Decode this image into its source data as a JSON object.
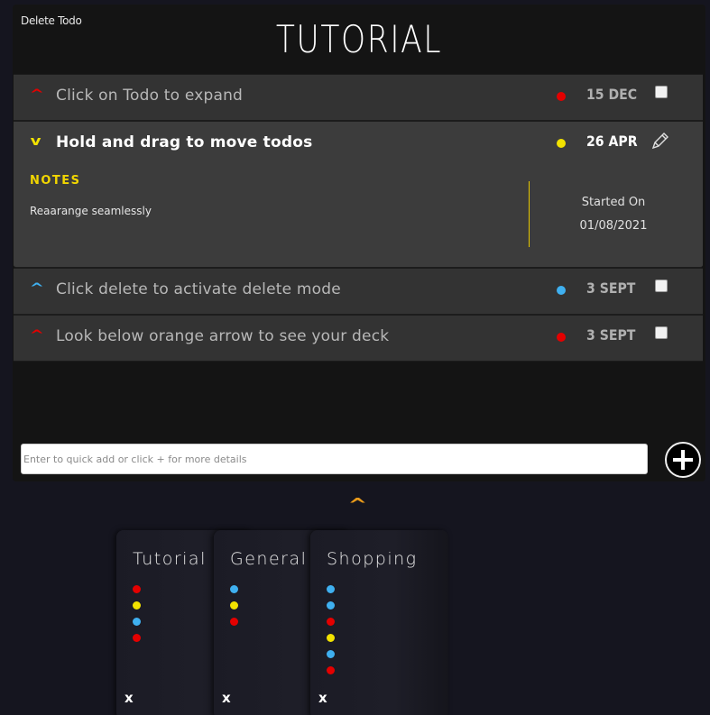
{
  "header": {
    "delete_label": "Delete Todo",
    "title": "TUTORIAL"
  },
  "colors": {
    "red": "#e40000",
    "yellow": "#f2e200",
    "blue": "#3fb0f0",
    "orange_arrow": "#e89a1a"
  },
  "todos": [
    {
      "text": "Click on Todo to expand",
      "date": "15 DEC",
      "color": "#e40000",
      "chevron": "^",
      "expanded": false
    },
    {
      "text": "Hold and drag to move todos",
      "date": "26 APR",
      "color": "#f2e200",
      "chevron": "v",
      "expanded": true,
      "notes_label": "NOTES",
      "notes": "Reaarange seamlessly",
      "started_label": "Started On",
      "started_date": "01/08/2021"
    },
    {
      "text": "Click delete to activate delete mode",
      "date": "3 SEPT",
      "color": "#3fb0f0",
      "chevron": "^",
      "expanded": false
    },
    {
      "text": "Look below orange arrow to see your deck",
      "date": "3 SEPT",
      "color": "#e40000",
      "chevron": "^",
      "expanded": false
    }
  ],
  "quick_add": {
    "placeholder": "Enter to quick add or click + for more details",
    "value": ""
  },
  "deck_arrow": "^",
  "decks": [
    {
      "name": "Tutorial",
      "dots": [
        "#e40000",
        "#f2e200",
        "#3fb0f0",
        "#e40000"
      ],
      "close": "x"
    },
    {
      "name": "General",
      "dots": [
        "#3fb0f0",
        "#f2e200",
        "#e40000"
      ],
      "close": "x"
    },
    {
      "name": "Shopping",
      "dots": [
        "#3fb0f0",
        "#3fb0f0",
        "#e40000",
        "#f2e200",
        "#3fb0f0",
        "#e40000"
      ],
      "close": "x"
    }
  ]
}
